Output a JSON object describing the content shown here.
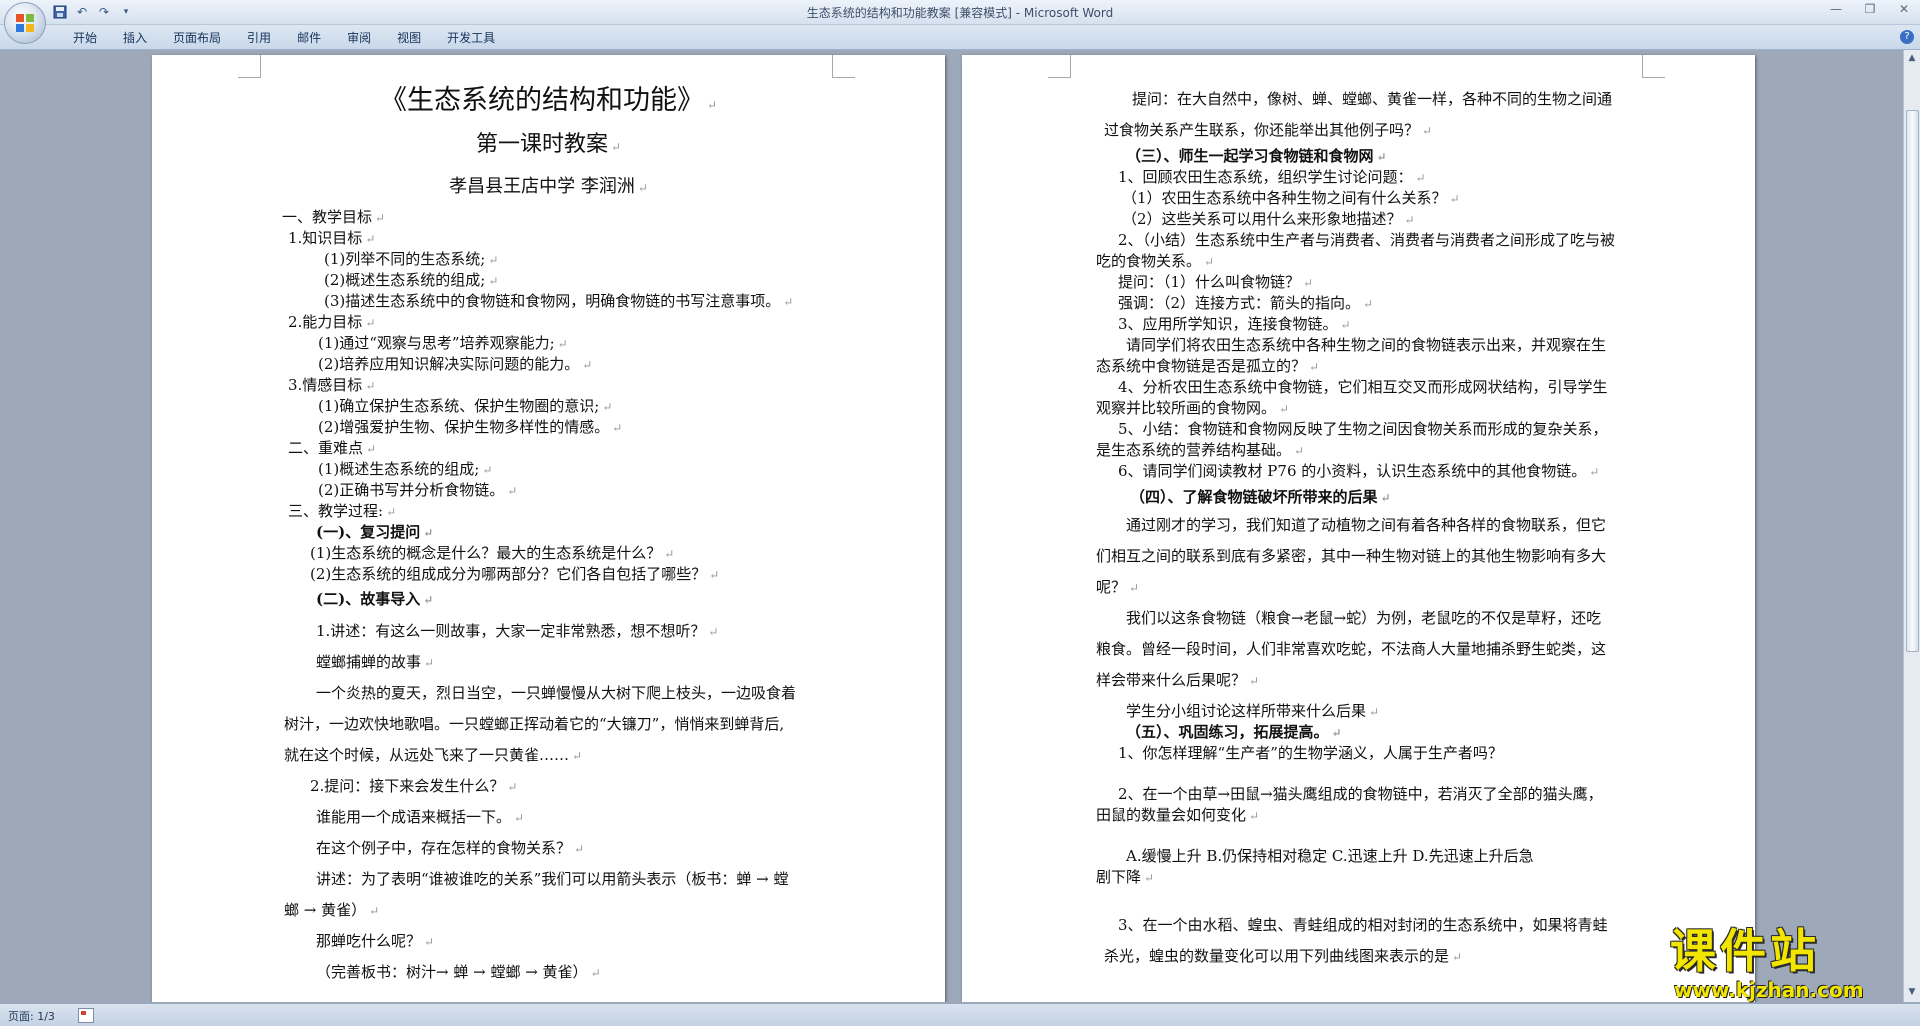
{
  "window": {
    "title": "生态系统的结构和功能教案 [兼容模式] - Microsoft Word"
  },
  "ribbon": {
    "tabs": [
      "开始",
      "插入",
      "页面布局",
      "引用",
      "邮件",
      "审阅",
      "视图",
      "开发工具"
    ]
  },
  "status": {
    "page": "页面: 1/3"
  },
  "watermark": {
    "text": "课件站",
    "url": "www.kjzhan.com"
  },
  "left_page": {
    "lines": [
      "《生态系统的结构和功能》",
      "第一课时教案",
      "孝昌县王店中学   李润洲",
      "一、教学目标",
      "1.知识目标",
      "(1)列举不同的生态系统;",
      "(2)概述生态系统的组成;",
      "(3)描述生态系统中的食物链和食物网，明确食物链的书写注意事项。",
      "2.能力目标",
      "(1)通过“观察与思考”培养观察能力;",
      "(2)培养应用知识解决实际问题的能力。",
      "3.情感目标",
      "(1)确立保护生态系统、保护生物圈的意识;",
      "(2)增强爱护生物、保护生物多样性的情感。",
      "二、重难点",
      "(1)概述生态系统的组成;",
      "(2)正确书写并分析食物链。",
      "三、教学过程:",
      "(一)、复习提问",
      "(1)生态系统的概念是什么？最大的生态系统是什么？",
      "(2)生态系统的组成成分为哪两部分？它们各自包括了哪些？",
      "(二)、故事导入",
      "1.讲述：有这么一则故事，大家一定非常熟悉，想不想听？",
      "螳螂捕蝉的故事",
      "一个炎热的夏天，烈日当空，一只蝉慢慢从大树下爬上枝头，一边吸食着",
      "树汁，一边欢快地歌唱。一只螳螂正挥动着它的“大镰刀”，悄悄来到蝉背后,",
      "就在这个时候，从远处飞来了一只黄雀……",
      "2.提问：接下来会发生什么？",
      "谁能用一个成语来概括一下。",
      "在这个例子中，存在怎样的食物关系？",
      "讲述：为了表明“谁被谁吃的关系”我们可以用箭头表示（板书：蝉 → 螳",
      "螂 → 黄雀）",
      "那蝉吃什么呢？",
      "（完善板书：树汁→ 蝉 → 螳螂 → 黄雀）"
    ]
  },
  "right_page": {
    "lines": [
      "提问：在大自然中，像树、蝉、螳螂、黄雀一样，各种不同的生物之间通",
      "过食物关系产生联系，你还能举出其他例子吗？",
      "（三）、师生一起学习食物链和食物网",
      "1、回顾农田生态系统，组织学生讨论问题：",
      "（1）农田生态系统中各种生物之间有什么关系？",
      "（2）这些关系可以用什么来形象地描述？",
      "2、（小结）生态系统中生产者与消费者、消费者与消费者之间形成了吃与被",
      "吃的食物关系。",
      "提问：（1）什么叫食物链？",
      "强调：（2）连接方式：箭头的指向。",
      "3、应用所学知识，连接食物链。",
      "请同学们将农田生态系统中各种生物之间的食物链表示出来，并观察在生",
      "态系统中食物链是否是孤立的？",
      "4、分析农田生态系统中食物链，它们相互交叉而形成网状结构，引导学生",
      "观察并比较所画的食物网。",
      "5、小结：食物链和食物网反映了生物之间因食物关系而形成的复杂关系，",
      "是生态系统的营养结构基础。",
      "6、请同学们阅读教材 P76 的小资料，认识生态系统中的其他食物链。",
      "（四）、了解食物链破坏所带来的后果",
      "通过刚才的学习，我们知道了动植物之间有着各种各样的食物联系，但它",
      "们相互之间的联系到底有多紧密，其中一种生物对链上的其他生物影响有多大",
      "呢？",
      "我们以这条食物链（粮食→老鼠→蛇）为例，老鼠吃的不仅是草籽，还吃",
      "粮食。曾经一段时间，人们非常喜欢吃蛇，不法商人大量地捕杀野生蛇类，这",
      "样会带来什么后果呢？",
      "学生分小组讨论这样所带来什么后果",
      "（五）、巩固练习，拓展提高。",
      "1、你怎样理解“生产者”的生物学涵义，人属于生产者吗？",
      "2、在一个由草→田鼠→猫头鹰组成的食物链中，若消灭了全部的猫头鹰，",
      "田鼠的数量会如何变化",
      "A.缓慢上升     B.仍保持相对稳定     C.迅速上升     D.先迅速上升后急",
      "剧下降",
      "3、在一个由水稻、蝗虫、青蛙组成的相对封闭的生态系统中，如果将青蛙",
      "杀光，蝗虫的数量变化可以用下列曲线图来表示的是"
    ]
  }
}
